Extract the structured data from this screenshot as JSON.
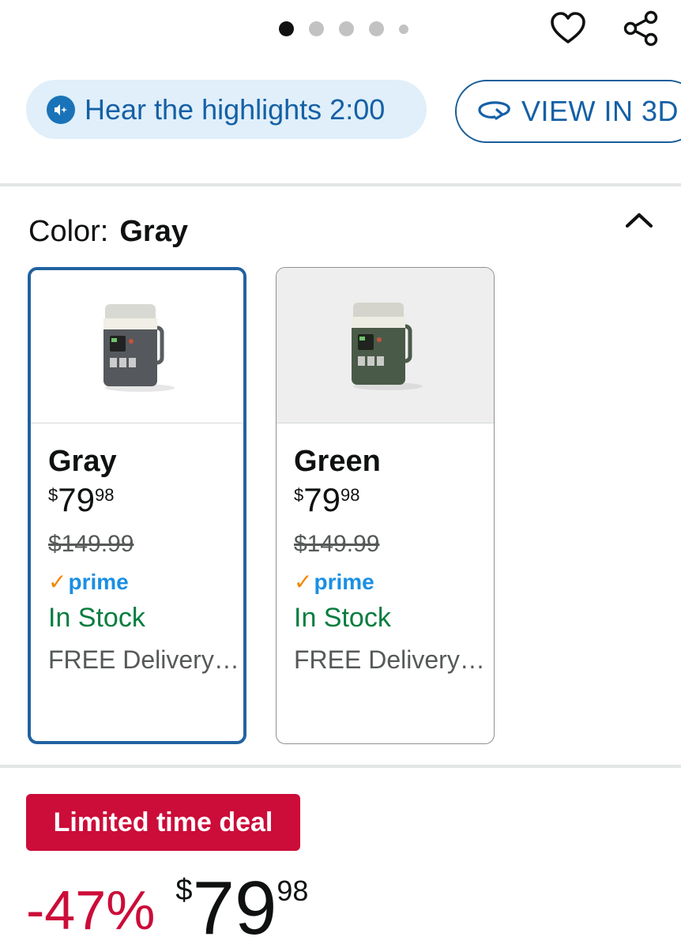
{
  "carousel": {
    "page_count": 5,
    "active_index": 0
  },
  "icons": {
    "wishlist": "heart-icon",
    "share": "share-icon",
    "audio": "audio-highlights-icon",
    "rotate": "rotate-3d-icon",
    "collapse": "chevron-up-icon"
  },
  "hear_highlights": {
    "label": "Hear the highlights 2:00"
  },
  "view_3d": {
    "label": "VIEW IN 3D"
  },
  "color_selector": {
    "label": "Color:",
    "selected": "Gray",
    "options": [
      {
        "name": "Gray",
        "currency": "$",
        "price_whole": "79",
        "price_fraction": "98",
        "list_price": "$149.99",
        "prime": "prime",
        "stock": "In Stock",
        "delivery": "FREE Delivery…",
        "selected": true
      },
      {
        "name": "Green",
        "currency": "$",
        "price_whole": "79",
        "price_fraction": "98",
        "list_price": "$149.99",
        "prime": "prime",
        "stock": "In Stock",
        "delivery": "FREE Delivery…",
        "selected": false
      }
    ]
  },
  "deal": {
    "badge": "Limited time deal",
    "discount": "-47%",
    "currency": "$",
    "price_whole": "79",
    "price_fraction": "98"
  },
  "colors": {
    "accent_blue": "#2162a1",
    "deal_red": "#cc0c39",
    "stock_green": "#067d3e",
    "prime_blue": "#1a8fe3",
    "prime_check": "#f08804"
  }
}
